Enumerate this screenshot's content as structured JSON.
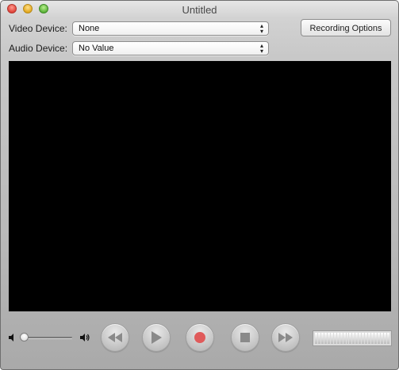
{
  "window": {
    "title": "Untitled"
  },
  "video_device": {
    "label": "Video Device:",
    "value": "None"
  },
  "audio_device": {
    "label": "Audio Device:",
    "value": "No Value"
  },
  "recording_options": {
    "label": "Recording Options"
  },
  "volume": {
    "level": 0.0
  },
  "icons": {
    "close": "close-icon",
    "minimize": "minimize-icon",
    "zoom": "zoom-icon",
    "volume_low": "speaker-low-icon",
    "volume_high": "speaker-high-icon",
    "rewind": "rewind-icon",
    "play": "play-icon",
    "record": "record-icon",
    "stop": "stop-icon",
    "fast_forward": "fast-forward-icon"
  },
  "colors": {
    "record": "#e05b5b",
    "video_background": "#000000"
  },
  "level_meter": {
    "level": 0.0
  }
}
